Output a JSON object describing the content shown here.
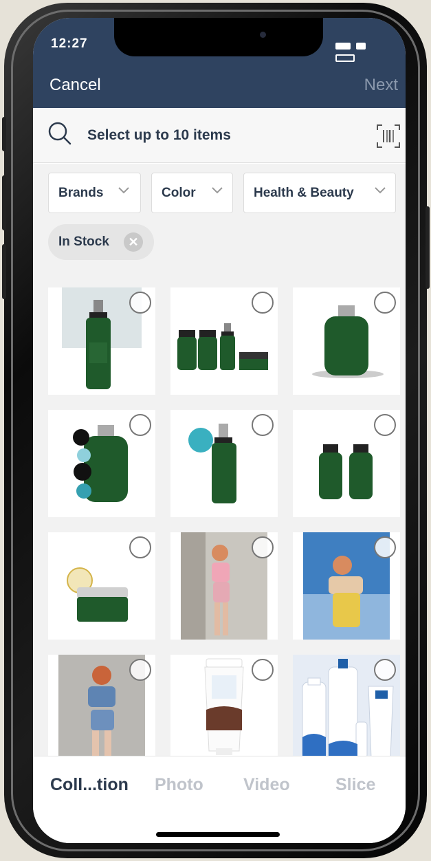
{
  "status": {
    "time": "12:27"
  },
  "nav": {
    "cancel": "Cancel",
    "next": "Next"
  },
  "search": {
    "placeholder": "Select up to 10 items",
    "icon": "search-icon",
    "scan_icon": "barcode-scan-icon"
  },
  "filters": [
    {
      "label": "Brands"
    },
    {
      "label": "Color"
    },
    {
      "label": "Health & Beauty"
    }
  ],
  "active_filter": {
    "label": "In Stock",
    "remove_icon": "clear-icon"
  },
  "grid": {
    "items": [
      {
        "kind": "serum-bottle-on-white"
      },
      {
        "kind": "product-set"
      },
      {
        "kind": "shampoo-bottle"
      },
      {
        "kind": "shampoo-bottle-with-badges"
      },
      {
        "kind": "serum-bottle-with-badge"
      },
      {
        "kind": "two-bottles"
      },
      {
        "kind": "jar"
      },
      {
        "kind": "photo-woman-pink-outfit"
      },
      {
        "kind": "photo-woman-yellow-outfit"
      },
      {
        "kind": "photo-woman-blue-outfit"
      },
      {
        "kind": "sunscreen-tube"
      },
      {
        "kind": "aftersun-products"
      }
    ]
  },
  "tabs": [
    {
      "label": "Coll...tion",
      "active": true
    },
    {
      "label": "Photo",
      "active": false
    },
    {
      "label": "Video",
      "active": false
    },
    {
      "label": "Slice",
      "active": false
    }
  ],
  "colors": {
    "navbar": "#2f4360",
    "text_dark": "#2c3a4d",
    "bottle_green": "#1f5a2b",
    "inactive_tab": "#c0c4cb"
  }
}
